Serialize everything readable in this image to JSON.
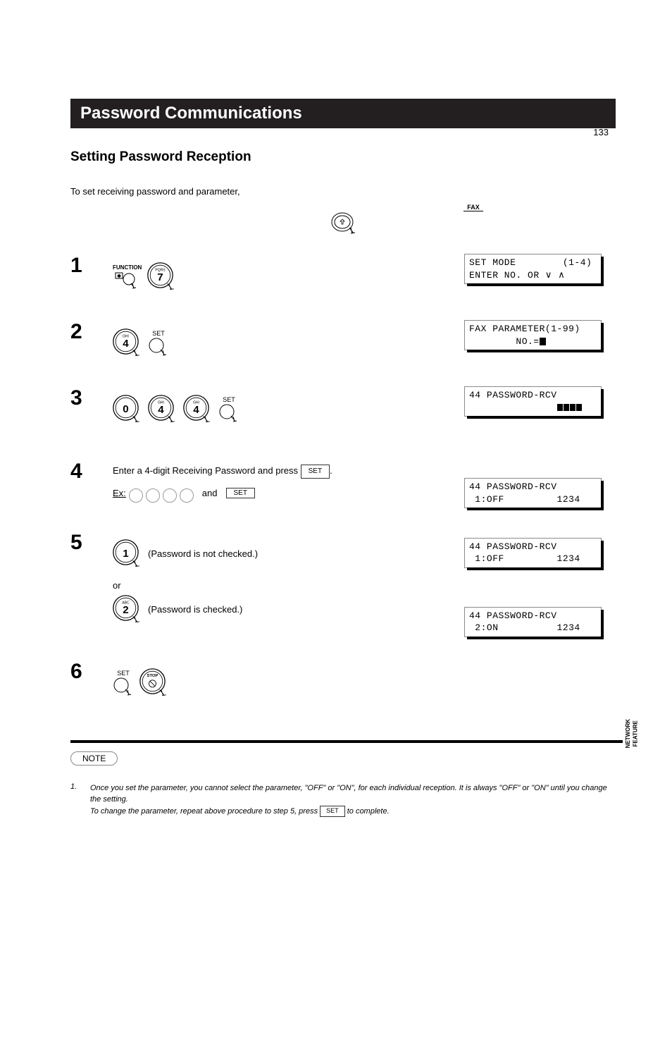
{
  "page_number_top": "133",
  "title_bar": "Password Communications",
  "section_heading": "Setting Password Reception",
  "intro_text": "To set receiving password and parameter,",
  "fax_label": "FAX",
  "steps": [
    {
      "num": "1",
      "lcd_line1": "SET MODE        (1-4)",
      "lcd_line2": "ENTER NO. OR ∨ ∧",
      "func_label": "FUNCTION",
      "digit_label": "PQRS",
      "digit": "7"
    },
    {
      "num": "2",
      "lcd_line1": "FAX PARAMETER(1-99)",
      "lcd_line2": "        NO.=",
      "digit_label": "GHI",
      "digit": "4",
      "set_label": "SET"
    },
    {
      "num": "3",
      "lcd_line1": "44 PASSWORD-RCV",
      "lcd_line2_mask": true,
      "d1_label": "",
      "d1": "0",
      "d2_label": "GHI",
      "d2": "4",
      "d3_label": "GHI",
      "d3": "4",
      "set_label": "SET"
    },
    {
      "num": "4",
      "text_a": "Enter a 4-digit Receiving Password and press ",
      "text_b": ".",
      "text_ex_prefix": "Ex:",
      "text_ex_suffix": " and ",
      "set_label": "SET",
      "lcd_line1": "44 PASSWORD-RCV",
      "lcd_line2": " 1:OFF         1234"
    },
    {
      "num": "5a",
      "lcd_line1": "44 PASSWORD-RCV",
      "lcd_line2": " 1:OFF         1234",
      "digit": "1",
      "desc": " (Password is not checked.)"
    },
    {
      "num": "5b",
      "or": "or",
      "digit_label": "ABC",
      "digit": "2",
      "desc": " (Password is checked.)",
      "lcd_line1": "44 PASSWORD-RCV",
      "lcd_line2": " 2:ON          1234"
    },
    {
      "num": "6",
      "set_label": "SET",
      "stop_label": "STOP"
    }
  ],
  "note_label": "NOTE",
  "note_num": "1.",
  "note_text_a": "Once you set the parameter, you cannot select the parameter, \"OFF\" or \"ON\", for each individual reception. It is always \"OFF\" or \"ON\" until you change the setting.",
  "note_text_b": "To change the parameter, repeat above procedure to step 5, press SET to complete.",
  "sidebar_line1": "NETWORK",
  "sidebar_line2": "FEATURE"
}
